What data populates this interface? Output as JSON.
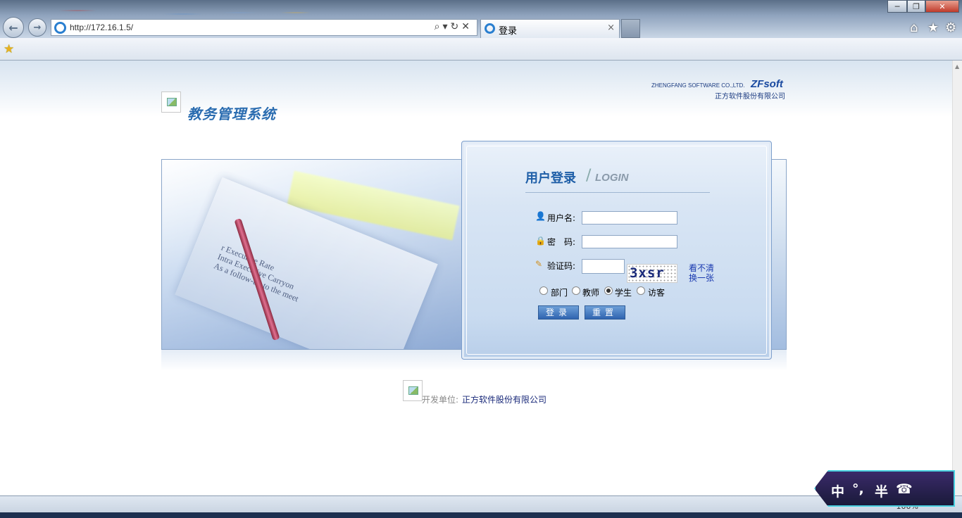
{
  "browser": {
    "url": "http://172.16.1.5/",
    "tab_title": "登录",
    "zoom": "100%",
    "tab_close": "×",
    "addr_tools": "⌕▾↻✕"
  },
  "page": {
    "system_title": "教务管理系统",
    "company_en": "ZHENGFANG SOFTWARE CO.,LTD.",
    "company_brand": "ZFsoft",
    "company_cn": "正方软件股份有限公司",
    "banner_text": "r Executive Rate\nIntra Executive Carryon\nAs a follow-up to the meet"
  },
  "login": {
    "title_cn": "用户登录",
    "title_sep": "/",
    "title_en": "LOGIN",
    "username_label": "用户名:",
    "password_label": "密　码:",
    "captcha_label": "验证码:",
    "captcha_text": "3xsr",
    "refresh_line1": "看不清",
    "refresh_line2": "换一张",
    "roles": [
      {
        "label": "部门",
        "checked": false
      },
      {
        "label": "教师",
        "checked": false
      },
      {
        "label": "学生",
        "checked": true
      },
      {
        "label": "访客",
        "checked": false
      }
    ],
    "login_button": "登录",
    "reset_button": "重置"
  },
  "footer": {
    "dev_label": "开发单位:",
    "dev_company": "正方软件股份有限公司"
  },
  "ime": {
    "keys": [
      "中",
      "°,",
      "半",
      "☎"
    ]
  }
}
